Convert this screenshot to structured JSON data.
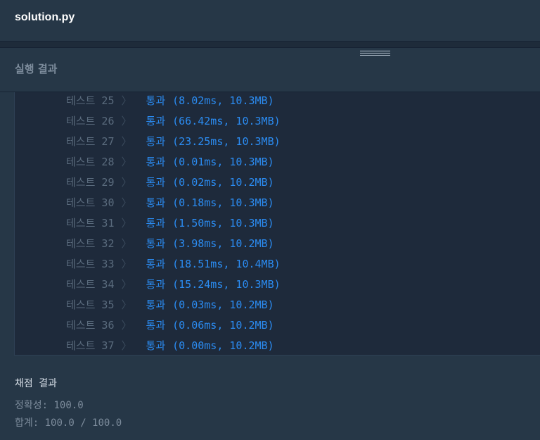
{
  "file": {
    "name": "solution.py"
  },
  "results_panel": {
    "title": "실행 결과"
  },
  "tests": [
    {
      "name": "테스트 25",
      "status": "통과",
      "detail": "(8.02ms, 10.3MB)"
    },
    {
      "name": "테스트 26",
      "status": "통과",
      "detail": "(66.42ms, 10.3MB)"
    },
    {
      "name": "테스트 27",
      "status": "통과",
      "detail": "(23.25ms, 10.3MB)"
    },
    {
      "name": "테스트 28",
      "status": "통과",
      "detail": "(0.01ms, 10.3MB)"
    },
    {
      "name": "테스트 29",
      "status": "통과",
      "detail": "(0.02ms, 10.2MB)"
    },
    {
      "name": "테스트 30",
      "status": "통과",
      "detail": "(0.18ms, 10.3MB)"
    },
    {
      "name": "테스트 31",
      "status": "통과",
      "detail": "(1.50ms, 10.3MB)"
    },
    {
      "name": "테스트 32",
      "status": "통과",
      "detail": "(3.98ms, 10.2MB)"
    },
    {
      "name": "테스트 33",
      "status": "통과",
      "detail": "(18.51ms, 10.4MB)"
    },
    {
      "name": "테스트 34",
      "status": "통과",
      "detail": "(15.24ms, 10.3MB)"
    },
    {
      "name": "테스트 35",
      "status": "통과",
      "detail": "(0.03ms, 10.2MB)"
    },
    {
      "name": "테스트 36",
      "status": "통과",
      "detail": "(0.06ms, 10.2MB)"
    },
    {
      "name": "테스트 37",
      "status": "통과",
      "detail": "(0.00ms, 10.2MB)"
    }
  ],
  "grading": {
    "title": "채점 결과",
    "accuracy": "정확성: 100.0",
    "total": "합계: 100.0 / 100.0"
  },
  "colors": {
    "background": "#263747",
    "console": "#1e2a3b",
    "pass": "#2b8cf2"
  }
}
